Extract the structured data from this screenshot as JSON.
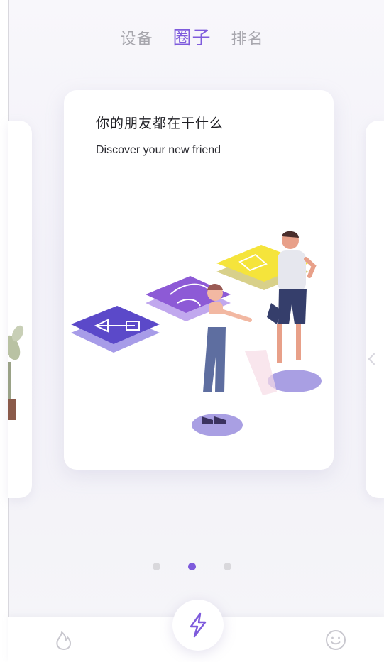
{
  "top_tabs": {
    "items": [
      {
        "label": "设备",
        "active": false
      },
      {
        "label": "圈子",
        "active": true
      },
      {
        "label": "排名",
        "active": false
      }
    ]
  },
  "card": {
    "title": "你的朋友都在干什么",
    "subtitle": "Discover your new friend"
  },
  "pager": {
    "total": 3,
    "active_index": 1
  },
  "bottom_nav": {
    "left_icon": "flame-icon",
    "center_icon": "lightning-icon",
    "right_icon": "smiley-icon"
  },
  "colors": {
    "accent": "#7e5bdc",
    "tile_blue": "#5b49c9",
    "tile_purple": "#8d5ad6",
    "tile_yellow": "#f5e43b",
    "icon_gray": "#c9c8cf"
  }
}
